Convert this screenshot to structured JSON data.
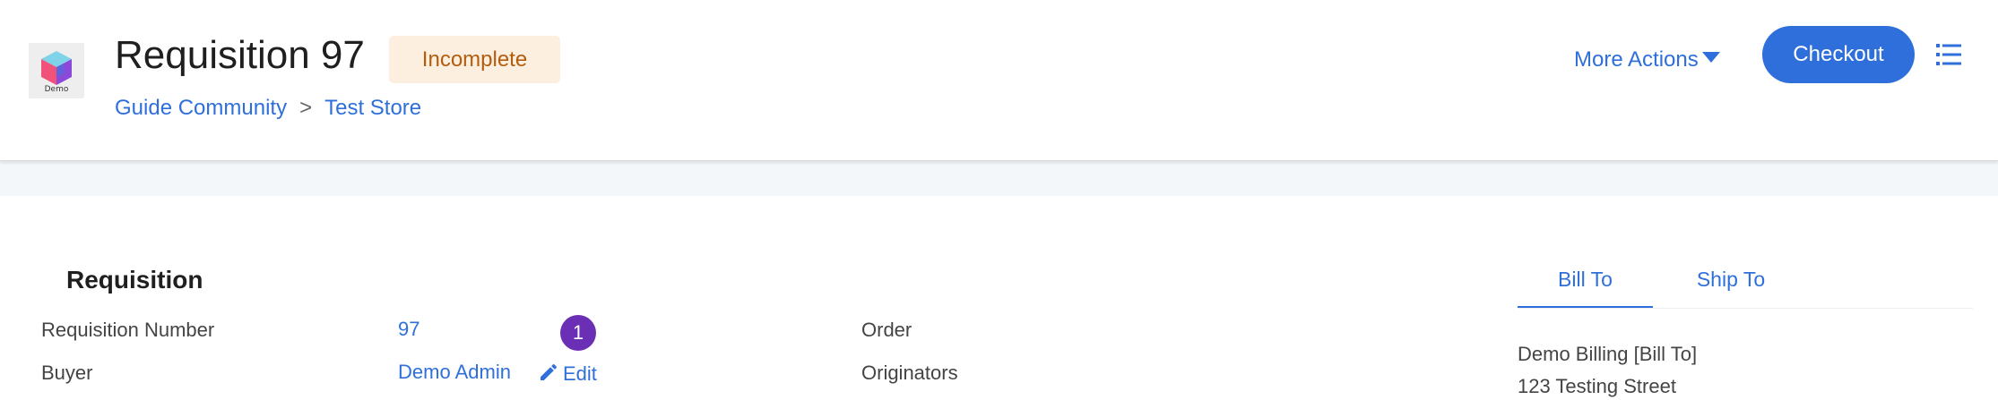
{
  "app": {
    "logo_text": "Demo",
    "logo_icon": "cube-icon"
  },
  "header": {
    "title": "Requisition 97",
    "status": "Incomplete",
    "breadcrumb": [
      "Guide Community",
      "Test Store"
    ],
    "breadcrumb_separator": ">",
    "more_actions_label": "More Actions",
    "checkout_label": "Checkout",
    "menu_icon": "list-icon"
  },
  "requisition": {
    "section_title": "Requisition",
    "fields": {
      "number_label": "Requisition Number",
      "number_value": "97",
      "buyer_label": "Buyer",
      "buyer_value": "Demo Admin",
      "edit_label": "Edit",
      "order_label": "Order",
      "originators_label": "Originators"
    },
    "step_badge": "1"
  },
  "address": {
    "tabs": [
      "Bill To",
      "Ship To"
    ],
    "active_tab": "Bill To",
    "lines": [
      "Demo Billing [Bill To]",
      "123 Testing Street"
    ]
  },
  "colors": {
    "accent": "#2f6fdb",
    "status_bg": "#fdefdf",
    "status_text": "#b35c0e",
    "step_badge": "#6a2fb5"
  }
}
